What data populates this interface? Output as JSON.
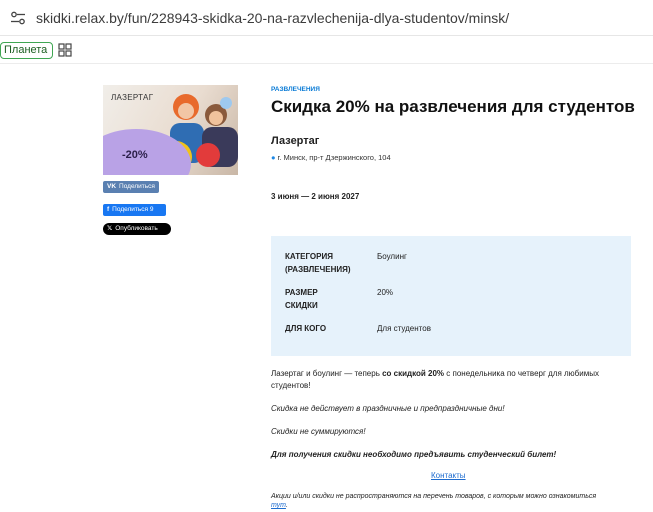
{
  "browser": {
    "url": "skidki.relax.by/fun/228943-skidka-20-na-razvlechenija-dlya-studentov/minsk/"
  },
  "bookmarks": {
    "planeta": "Планета"
  },
  "hero": {
    "tag": "ЛАЗЕРТАГ",
    "percent": "-20%"
  },
  "share": {
    "vk": "Поделиться",
    "fb": "Поделиться 9",
    "x": "Опубликовать"
  },
  "deal": {
    "category": "РАЗВЛЕЧЕНИЯ",
    "title": "Скидка 20% на развлечения для студентов",
    "place": "Лазертаг",
    "address": "г. Минск, пр-т Дзержинского, 104",
    "dates": "3 июня — 2 июня 2027"
  },
  "info": {
    "category_label_1": "КАТЕГОРИЯ",
    "category_label_2": "(РАЗВЛЕЧЕНИЯ)",
    "category_value": "Боулинг",
    "size_label_1": "РАЗМЕР",
    "size_label_2": "СКИДКИ",
    "size_value": "20%",
    "for_label": "ДЛЯ КОГО",
    "for_value": "Для студентов"
  },
  "description": {
    "p1_a": "Лазертаг и боулинг — теперь ",
    "p1_b": "со скидкой 20%",
    "p1_c": " с понедельника по четверг для любимых студентов!",
    "p2": "Скидка не действует в праздничные и предпраздничные дни!",
    "p3": "Скидки не суммируются!",
    "p4": "Для получения скидки необходимо предъявить студенческий билет!",
    "contacts": "Контакты",
    "footnote_a": "Акции и/или скидки не распространяются на перечень товаров, с которым можно ознакомиться ",
    "footnote_link": "тут",
    "footnote_b": "."
  },
  "colors": {
    "accent": "#0a7bd6",
    "info_bg": "#e6f2fb",
    "vk": "#5a80b1",
    "fb": "#1877f2"
  }
}
